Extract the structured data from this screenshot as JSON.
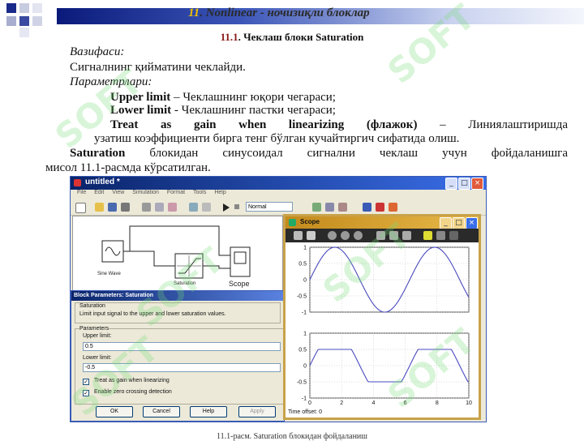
{
  "header": {
    "number": "11",
    "title": ". Nonlinear - ночизиқли блоклар"
  },
  "section": {
    "number": "11.1",
    "title": ". Чеклаш блоки Saturation"
  },
  "body": {
    "purpose_label": "Вазифаси:",
    "purpose_text": "Сигналнинг қийматини чеклайди.",
    "params_label": "Параметрлари:",
    "p1_name": "Upper limit",
    "p1_text": " – Чеклашнинг юқори чегараси;",
    "p2_name": "Lower limit",
    "p2_text": " - Чеклашнинг пастки чегараси;",
    "p3_name": "Treat as gain when linearizing (флажок)",
    "p3_text_a": " – Линиялаштиришда",
    "p3_text_b": "узатиш коэффициенти бирга тенг бўлган кучайтиргич сифатида олиш.",
    "sat_name": "Saturation",
    "sat_text_a": " блокидан синусоидал сигнални чеклаш учун фойдаланишга",
    "sat_text_b": "мисол 11.1-расмда кўрсатилган."
  },
  "watermark": "SOFT",
  "simulink": {
    "window_title": "untitled *",
    "menu": [
      "File",
      "Edit",
      "View",
      "Simulation",
      "Format",
      "Tools",
      "Help"
    ],
    "mode": "Normal",
    "blocks": {
      "sine": "Sine Wave",
      "saturation": "Saturation",
      "scope": "Scope"
    },
    "dialog": {
      "title": "Block Parameters: Saturation",
      "block_name": "Saturation",
      "description": "Limit input signal to the upper and lower saturation values.",
      "params_group": "Parameters",
      "upper_label": "Upper limit:",
      "upper_value": "0.5",
      "lower_label": "Lower limit:",
      "lower_value": "-0.5",
      "chk1": "Treat as gain when linearizing",
      "chk2": "Enable zero crossing detection",
      "check_mark": "✓",
      "btn_ok": "OK",
      "btn_cancel": "Cancel",
      "btn_help": "Help",
      "btn_apply": "Apply"
    }
  },
  "scope": {
    "title": "Scope",
    "time_offset": "Time offset:  0",
    "x_ticks": [
      "0",
      "2",
      "4",
      "6",
      "8",
      "10"
    ],
    "top_y_ticks": [
      "1",
      "0.5",
      "0",
      "-0.5",
      "-1"
    ],
    "bottom_y_ticks": [
      "1",
      "0.5",
      "0",
      "-0.5",
      "-1"
    ]
  },
  "chart_data": [
    {
      "type": "line",
      "x_range": [
        0,
        10
      ],
      "ylim": [
        -1,
        1
      ],
      "grid": true,
      "series": [
        {
          "function": "sin(t)",
          "color": "#4a4ac0"
        }
      ]
    },
    {
      "type": "line",
      "x_range": [
        0,
        10
      ],
      "ylim": [
        -1,
        1
      ],
      "grid": true,
      "series": [
        {
          "function": "clip(sin(t), -0.5, 0.5)",
          "color": "#4a4ac0"
        }
      ]
    }
  ],
  "caption": "11.1-расм. Saturation блокидан фойдаланиш"
}
